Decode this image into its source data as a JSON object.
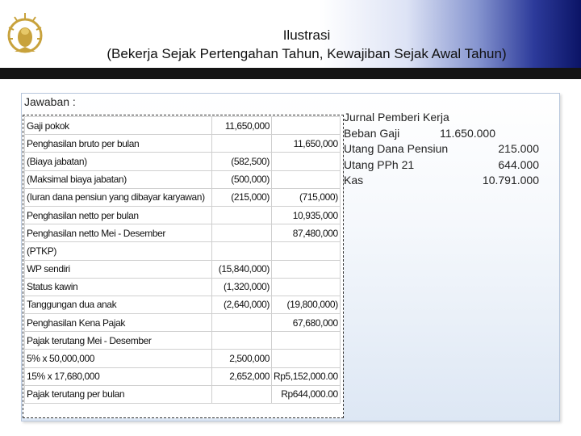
{
  "header": {
    "title_line1": "Ilustrasi",
    "title_line2": "(Bekerja Sejak Pertengahan Tahun, Kewajiban Sejak Awal Tahun)"
  },
  "colors": {
    "header_dark": "#0b1466",
    "header_bar": "#141414",
    "panel_tint": "#dde7f4"
  },
  "icons": {
    "logo": "garuda-emblem-logo"
  },
  "content": {
    "jawaban_label": "Jawaban  :",
    "calc_rows": [
      {
        "label": "Gaji pokok",
        "col1": "11,650,000",
        "col2": ""
      },
      {
        "label": "Penghasilan bruto per bulan",
        "col1": "",
        "col2": "11,650,000"
      },
      {
        "label": "(Biaya jabatan)",
        "col1": "(582,500)",
        "col2": ""
      },
      {
        "label": "(Maksimal biaya jabatan)",
        "col1": "(500,000)",
        "col2": ""
      },
      {
        "label": "(Iuran dana pensiun yang dibayar karyawan)",
        "col1": "(215,000)",
        "col2": "(715,000)"
      },
      {
        "label": "Penghasilan netto per bulan",
        "col1": "",
        "col2": "10,935,000"
      },
      {
        "label": "Penghasilan netto Mei - Desember",
        "col1": "",
        "col2": "87,480,000"
      },
      {
        "label": "(PTKP)",
        "col1": "",
        "col2": ""
      },
      {
        "label": "WP sendiri",
        "col1": "(15,840,000)",
        "col2": ""
      },
      {
        "label": "Status kawin",
        "col1": "(1,320,000)",
        "col2": ""
      },
      {
        "label": "Tanggungan dua anak",
        "col1": "(2,640,000)",
        "col2": "(19,800,000)"
      },
      {
        "label": "Penghasilan Kena Pajak",
        "col1": "",
        "col2": "67,680,000"
      },
      {
        "label": "Pajak terutang Mei - Desember",
        "col1": "",
        "col2": ""
      },
      {
        "label": "5% x 50,000,000",
        "col1": "2,500,000",
        "col2": ""
      },
      {
        "label": "15% x 17,680,000",
        "col1": "2,652,000",
        "col2": "Rp5,152,000.00"
      },
      {
        "label": "Pajak terutang per bulan",
        "col1": "",
        "col2": "Rp644,000.00"
      }
    ],
    "jurnal": {
      "title": "Jurnal Pemberi Kerja",
      "entries": [
        {
          "name": "Beban Gaji",
          "amount": "11.650.000"
        },
        {
          "name": "Utang Dana Pensiun",
          "amount": "215.000"
        },
        {
          "name": "Utang PPh 21",
          "amount": "644.000"
        },
        {
          "name": "Kas",
          "amount": "10.791.000"
        }
      ]
    }
  }
}
